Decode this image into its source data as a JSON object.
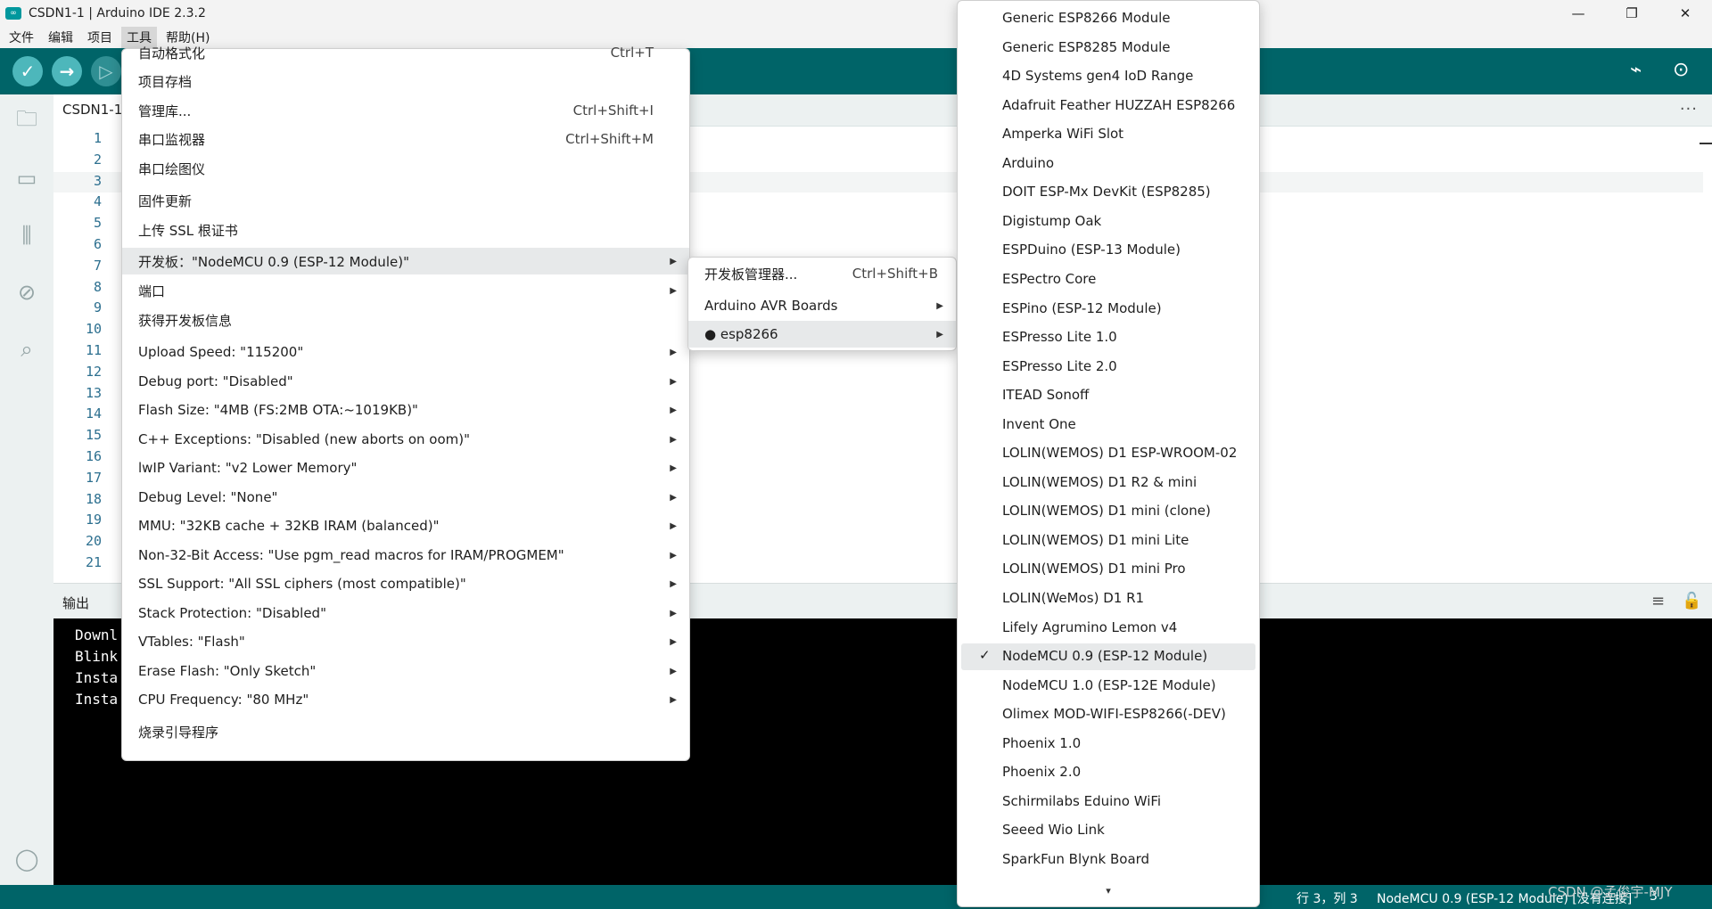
{
  "window": {
    "title": "CSDN1-1 | Arduino IDE 2.3.2",
    "logo": "∞",
    "minimize": "—",
    "maximize": "❐",
    "close": "✕"
  },
  "menubar": [
    "文件",
    "编辑",
    "项目",
    "工具",
    "帮助(H)"
  ],
  "toolbar": {
    "verify_icon": "✓",
    "upload_icon": "→",
    "debug_icon": "▷",
    "serial_plotter_icon": "⌁",
    "serial_monitor_icon": "⊙"
  },
  "sidebar_icons": {
    "folder": "🗀",
    "boards": "▭",
    "library": "⫼",
    "debug": "⊘",
    "search": "⌕",
    "account": "◯"
  },
  "editor": {
    "tab": "CSDN1-1",
    "more": "···",
    "line_numbers": [
      "1",
      "2",
      "3",
      "4",
      "5",
      "6",
      "7",
      "8",
      "9",
      "10",
      "11",
      "12",
      "13",
      "14",
      "15",
      "16",
      "17",
      "18",
      "19",
      "20",
      "21"
    ]
  },
  "output": {
    "title": "输出",
    "clear_icon": "≡",
    "lock_icon": "🔓",
    "lines": [
      "Downl",
      "Blink",
      "Insta",
      "Insta"
    ]
  },
  "statusbar": {
    "position": "行 3，列 3",
    "board": "NodeMCU 0.9 (ESP-12 Module) [没有连接]",
    "count": "3"
  },
  "watermark": "CSDN @孟俊宇-MJY",
  "tools_menu": {
    "items": [
      {
        "label": "自动格式化",
        "shortcut": "Ctrl+T",
        "arrow": ""
      },
      {
        "label": "项目存档",
        "shortcut": "",
        "arrow": ""
      },
      {
        "label": "管理库...",
        "shortcut": "Ctrl+Shift+I",
        "arrow": ""
      },
      {
        "label": "串口监视器",
        "shortcut": "Ctrl+Shift+M",
        "arrow": ""
      },
      {
        "label": "串口绘图仪",
        "shortcut": "",
        "arrow": ""
      },
      {
        "label": "固件更新",
        "shortcut": "",
        "arrow": ""
      },
      {
        "label": "上传 SSL 根证书",
        "shortcut": "",
        "arrow": ""
      },
      {
        "label": "开发板：\"NodeMCU 0.9 (ESP-12 Module)\"",
        "shortcut": "",
        "arrow": "▶"
      },
      {
        "label": "端口",
        "shortcut": "",
        "arrow": "▶"
      },
      {
        "label": "获得开发板信息",
        "shortcut": "",
        "arrow": ""
      },
      {
        "label": "Upload Speed: \"115200\"",
        "shortcut": "",
        "arrow": "▶"
      },
      {
        "label": "Debug port: \"Disabled\"",
        "shortcut": "",
        "arrow": "▶"
      },
      {
        "label": "Flash Size: \"4MB (FS:2MB OTA:~1019KB)\"",
        "shortcut": "",
        "arrow": "▶"
      },
      {
        "label": "C++ Exceptions: \"Disabled (new aborts on oom)\"",
        "shortcut": "",
        "arrow": "▶"
      },
      {
        "label": "lwIP Variant: \"v2 Lower Memory\"",
        "shortcut": "",
        "arrow": "▶"
      },
      {
        "label": "Debug Level: \"None\"",
        "shortcut": "",
        "arrow": "▶"
      },
      {
        "label": "MMU: \"32KB cache + 32KB IRAM (balanced)\"",
        "shortcut": "",
        "arrow": "▶"
      },
      {
        "label": "Non-32-Bit Access: \"Use pgm_read macros for IRAM/PROGMEM\"",
        "shortcut": "",
        "arrow": "▶"
      },
      {
        "label": "SSL Support: \"All SSL ciphers (most compatible)\"",
        "shortcut": "",
        "arrow": "▶"
      },
      {
        "label": "Stack Protection: \"Disabled\"",
        "shortcut": "",
        "arrow": "▶"
      },
      {
        "label": "VTables: \"Flash\"",
        "shortcut": "",
        "arrow": "▶"
      },
      {
        "label": "Erase Flash: \"Only Sketch\"",
        "shortcut": "",
        "arrow": "▶"
      },
      {
        "label": "CPU Frequency: \"80 MHz\"",
        "shortcut": "",
        "arrow": "▶"
      },
      {
        "label": "烧录引导程序",
        "shortcut": "",
        "arrow": ""
      }
    ]
  },
  "board_submenu": {
    "items": [
      {
        "label": "开发板管理器...",
        "shortcut": "Ctrl+Shift+B",
        "arrow": ""
      },
      {
        "label": "Arduino AVR Boards",
        "shortcut": "",
        "arrow": "▶"
      },
      {
        "label": "● esp8266",
        "shortcut": "",
        "arrow": "▶"
      }
    ]
  },
  "esp8266_boards": {
    "check": "✓",
    "more": "▾",
    "items": [
      "Generic ESP8266 Module",
      "Generic ESP8285 Module",
      "4D Systems gen4 IoD Range",
      "Adafruit Feather HUZZAH ESP8266",
      "Amperka WiFi Slot",
      "Arduino",
      "DOIT ESP-Mx DevKit (ESP8285)",
      "Digistump Oak",
      "ESPDuino (ESP-13 Module)",
      "ESPectro Core",
      "ESPino (ESP-12 Module)",
      "ESPresso Lite 1.0",
      "ESPresso Lite 2.0",
      "ITEAD Sonoff",
      "Invent One",
      "LOLIN(WEMOS) D1 ESP-WROOM-02",
      "LOLIN(WEMOS) D1 R2 & mini",
      "LOLIN(WEMOS) D1 mini (clone)",
      "LOLIN(WEMOS) D1 mini Lite",
      "LOLIN(WEMOS) D1 mini Pro",
      "LOLIN(WeMos) D1 R1",
      "Lifely Agrumino Lemon v4",
      "NodeMCU 0.9 (ESP-12 Module)",
      "NodeMCU 1.0 (ESP-12E Module)",
      "Olimex MOD-WIFI-ESP8266(-DEV)",
      "Phoenix 1.0",
      "Phoenix 2.0",
      "Schirmilabs Eduino WiFi",
      "Seeed Wio Link",
      "SparkFun Blynk Board"
    ]
  }
}
